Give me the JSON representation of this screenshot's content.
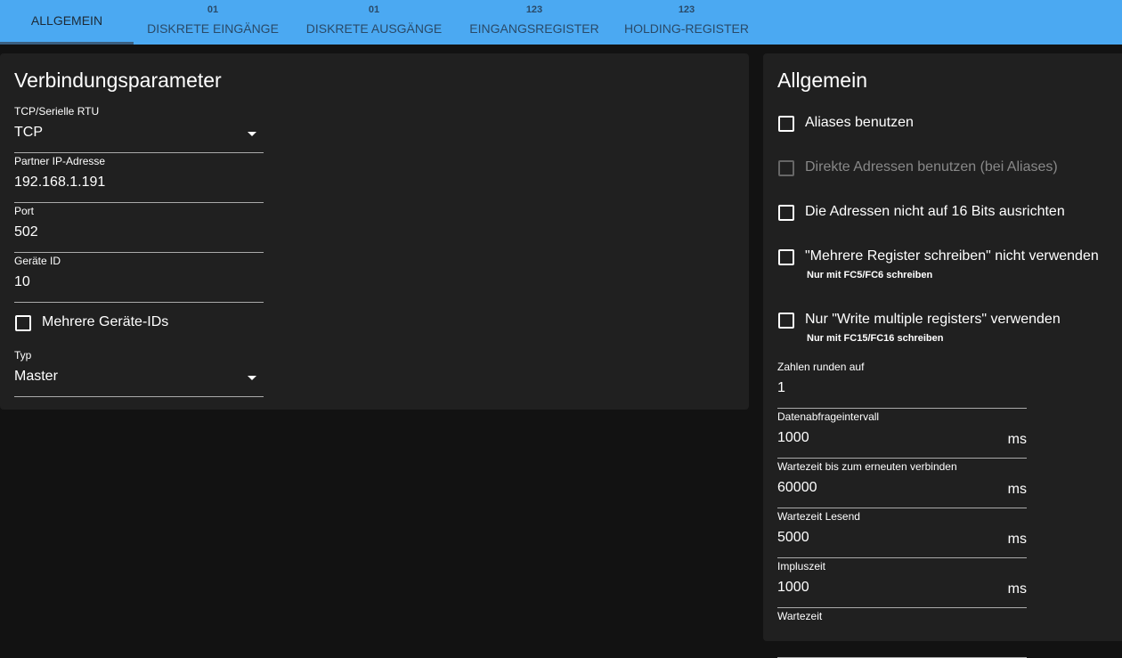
{
  "tabs": [
    {
      "label": "ALLGEMEIN",
      "badge": ""
    },
    {
      "label": "DISKRETE EINGÄNGE",
      "badge": "01"
    },
    {
      "label": "DISKRETE AUSGÄNGE",
      "badge": "01"
    },
    {
      "label": "EINGANGSREGISTER",
      "badge": "123"
    },
    {
      "label": "HOLDING-REGISTER",
      "badge": "123"
    }
  ],
  "left": {
    "title": "Verbindungsparameter",
    "mode": {
      "label": "TCP/Serielle RTU",
      "value": "TCP"
    },
    "ip": {
      "label": "Partner IP-Adresse",
      "value": "192.168.1.191"
    },
    "port": {
      "label": "Port",
      "value": "502"
    },
    "device_id": {
      "label": "Geräte ID",
      "value": "10"
    },
    "multi_ids": {
      "label": "Mehrere Geräte-IDs",
      "checked": false
    },
    "type": {
      "label": "Typ",
      "value": "Master"
    }
  },
  "right": {
    "title": "Allgemein",
    "checkboxes": [
      {
        "label": "Aliases benutzen",
        "checked": false
      },
      {
        "label": "Direkte Adressen benutzen (bei Aliases)",
        "checked": false,
        "disabled": true
      },
      {
        "label": "Die Adressen nicht auf 16 Bits ausrichten",
        "checked": false
      },
      {
        "label": "\"Mehrere Register schreiben\" nicht verwenden",
        "sub": "Nur mit FC5/FC6 schreiben",
        "checked": false
      },
      {
        "label": "Nur \"Write multiple registers\" verwenden",
        "sub": "Nur mit FC15/FC16 schreiben",
        "checked": false
      }
    ],
    "fields": [
      {
        "label": "Zahlen runden auf",
        "value": "1",
        "unit": ""
      },
      {
        "label": "Datenabfrageintervall",
        "value": "1000",
        "unit": "ms"
      },
      {
        "label": "Wartezeit bis zum erneuten verbinden",
        "value": "60000",
        "unit": "ms"
      },
      {
        "label": "Wartezeit Lesend",
        "value": "5000",
        "unit": "ms"
      },
      {
        "label": "Impluszeit",
        "value": "1000",
        "unit": "ms"
      },
      {
        "label": "Wartezeit",
        "value": "",
        "unit": ""
      }
    ]
  }
}
